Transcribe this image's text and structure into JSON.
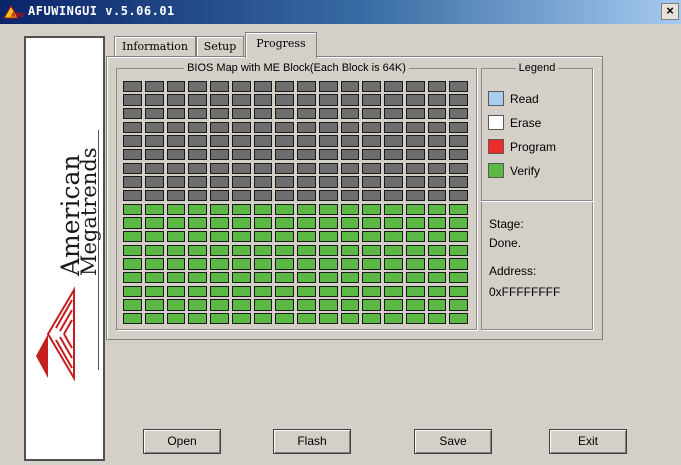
{
  "window": {
    "title": "AFUWINGUI v.5.06.01",
    "icon_name": "ami-app-icon",
    "close_label": "×"
  },
  "logo": {
    "line1": "American",
    "line2": "Megatrends",
    "icon_name": "ami-pyramid-logo"
  },
  "tabs": [
    {
      "label": "Information",
      "active": false
    },
    {
      "label": "Setup",
      "active": false
    },
    {
      "label": "Progress",
      "active": true
    }
  ],
  "bios_map": {
    "legend": "BIOS Map with ME Block(Each Block is 64K)",
    "columns": 16,
    "rows": 18,
    "gray_rows": 9,
    "green_rows": 9,
    "state_colors": {
      "pending": "#6e6e6e",
      "verify": "#5cb845"
    }
  },
  "legend": {
    "title": "Legend",
    "items": [
      {
        "label": "Read",
        "color": "#a9cdee"
      },
      {
        "label": "Erase",
        "color": "#ffffff"
      },
      {
        "label": "Program",
        "color": "#ee2b2b"
      },
      {
        "label": "Verify",
        "color": "#5cb845"
      }
    ]
  },
  "status": {
    "stage_label": "Stage:",
    "stage_value": "Done.",
    "address_label": "Address:",
    "address_value": "0xFFFFFFFF"
  },
  "buttons": {
    "open": "Open",
    "flash": "Flash",
    "save": "Save",
    "exit": "Exit"
  }
}
